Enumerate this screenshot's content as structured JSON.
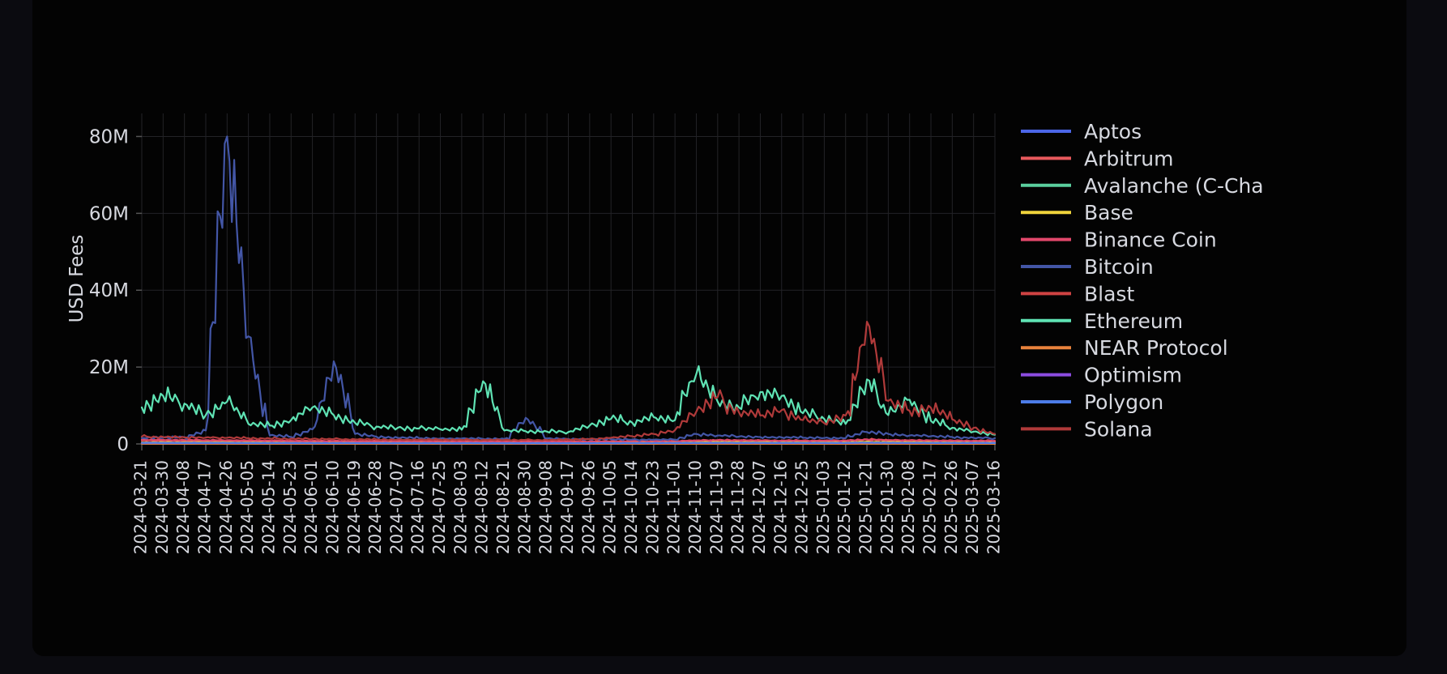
{
  "page": {
    "background_color": "#0b0b10",
    "card_color": "#030303"
  },
  "chart_data": {
    "type": "line",
    "title": "",
    "xlabel": "",
    "ylabel": "USD Fees",
    "ylim": [
      0,
      86000000
    ],
    "yticks": [
      0,
      20000000,
      40000000,
      60000000,
      80000000
    ],
    "ytick_labels": [
      "0",
      "20M",
      "40M",
      "60M",
      "80M"
    ],
    "grid": true,
    "legend_position": "right",
    "x_label_rotation": -90,
    "categories": [
      "2024-03-21",
      "2024-03-30",
      "2024-04-08",
      "2024-04-17",
      "2024-04-26",
      "2024-05-05",
      "2024-05-14",
      "2024-05-23",
      "2024-06-01",
      "2024-06-10",
      "2024-06-19",
      "2024-06-28",
      "2024-07-07",
      "2024-07-16",
      "2024-07-25",
      "2024-08-03",
      "2024-08-12",
      "2024-08-21",
      "2024-08-30",
      "2024-09-08",
      "2024-09-17",
      "2024-09-26",
      "2024-10-05",
      "2024-10-14",
      "2024-10-23",
      "2024-11-01",
      "2024-11-10",
      "2024-11-19",
      "2024-11-28",
      "2024-12-07",
      "2024-12-16",
      "2024-12-25",
      "2025-01-03",
      "2025-01-12",
      "2025-01-21",
      "2025-01-30",
      "2025-02-08",
      "2025-02-17",
      "2025-02-26",
      "2025-03-07",
      "2025-03-16"
    ],
    "series": [
      {
        "name": "Aptos",
        "color": "#4c66e8",
        "values": [
          30000,
          28000,
          26000,
          40000,
          35000,
          30000,
          28000,
          26000,
          25000,
          24000,
          23000,
          22000,
          21000,
          20000,
          20000,
          19000,
          19000,
          18000,
          18000,
          17000,
          17000,
          16000,
          16000,
          15000,
          15000,
          15000,
          14000,
          14000,
          14000,
          13000,
          13000,
          13000,
          12000,
          12000,
          12000,
          11000,
          11000,
          11000,
          10000,
          10000,
          10000
        ]
      },
      {
        "name": "Arbitrum",
        "color": "#e8595c",
        "values": [
          900000,
          850000,
          820000,
          800000,
          760000,
          700000,
          650000,
          620000,
          600000,
          580000,
          550000,
          520000,
          500000,
          480000,
          460000,
          440000,
          430000,
          420000,
          410000,
          400000,
          420000,
          450000,
          480000,
          520000,
          560000,
          620000,
          800000,
          900000,
          850000,
          800000,
          760000,
          700000,
          680000,
          700000,
          1200000,
          900000,
          820000,
          780000,
          700000,
          650000,
          600000
        ]
      },
      {
        "name": "Avalanche (C-Cha",
        "color": "#5bcf9e",
        "values": [
          250000,
          240000,
          230000,
          220000,
          210000,
          200000,
          190000,
          185000,
          180000,
          175000,
          170000,
          165000,
          160000,
          158000,
          155000,
          152000,
          150000,
          148000,
          146000,
          144000,
          142000,
          140000,
          150000,
          160000,
          170000,
          180000,
          200000,
          220000,
          210000,
          200000,
          190000,
          185000,
          180000,
          178000,
          200000,
          190000,
          180000,
          175000,
          170000,
          165000,
          160000
        ]
      },
      {
        "name": "Base",
        "color": "#f0d43c",
        "values": [
          400000,
          420000,
          450000,
          430000,
          410000,
          390000,
          370000,
          350000,
          340000,
          330000,
          320000,
          310000,
          300000,
          295000,
          290000,
          285000,
          280000,
          275000,
          270000,
          268000,
          270000,
          280000,
          300000,
          320000,
          340000,
          370000,
          450000,
          500000,
          480000,
          460000,
          440000,
          420000,
          410000,
          420000,
          600000,
          500000,
          470000,
          450000,
          420000,
          400000,
          380000
        ]
      },
      {
        "name": "Binance Coin",
        "color": "#e2486b",
        "values": [
          1100000,
          1050000,
          1000000,
          980000,
          950000,
          900000,
          860000,
          830000,
          800000,
          780000,
          760000,
          740000,
          720000,
          710000,
          700000,
          690000,
          680000,
          670000,
          665000,
          660000,
          665000,
          680000,
          700000,
          720000,
          750000,
          790000,
          900000,
          1000000,
          960000,
          930000,
          900000,
          870000,
          860000,
          880000,
          1100000,
          1000000,
          950000,
          920000,
          880000,
          850000,
          820000
        ]
      },
      {
        "name": "Bitcoin",
        "color": "#4356a6",
        "values": [
          1500000,
          1600000,
          1800000,
          3500000,
          80000000,
          28000000,
          2200000,
          1800000,
          3800000,
          21500000,
          2600000,
          1900000,
          1600000,
          1500000,
          1400000,
          1400000,
          1300000,
          1300000,
          6800000,
          1400000,
          1300000,
          1200000,
          1200000,
          1150000,
          1100000,
          1100000,
          2600000,
          2200000,
          1900000,
          1800000,
          1700000,
          1600000,
          1550000,
          1500000,
          3100000,
          2600000,
          2200000,
          2000000,
          1800000,
          1600000,
          1500000
        ]
      },
      {
        "name": "Blast",
        "color": "#cf4343",
        "values": [
          120000,
          115000,
          110000,
          105000,
          100000,
          95000,
          92000,
          90000,
          88000,
          86000,
          84000,
          82000,
          80000,
          79000,
          78000,
          77000,
          76000,
          75000,
          74000,
          73000,
          72000,
          71000,
          70000,
          69000,
          68000,
          67000,
          66000,
          65000,
          64000,
          63000,
          62000,
          61000,
          60000,
          59000,
          58000,
          57000,
          56000,
          55000,
          54000,
          53000,
          52000
        ]
      },
      {
        "name": "Ethereum",
        "color": "#5fe3b4",
        "values": [
          9500000,
          12500000,
          10500000,
          7500000,
          11000000,
          5200000,
          4800000,
          6200000,
          9500000,
          7500000,
          5500000,
          4500000,
          4200000,
          4000000,
          3800000,
          3700000,
          16300000,
          3500000,
          3300000,
          3200000,
          3100000,
          4800000,
          6500000,
          5500000,
          7000000,
          6200000,
          18200000,
          11000000,
          9500000,
          13500000,
          12500000,
          8000000,
          6500000,
          5200000,
          16800000,
          7500000,
          11500000,
          6000000,
          4200000,
          3200000,
          2400000
        ]
      },
      {
        "name": "NEAR Protocol",
        "color": "#e8823c",
        "values": [
          60000,
          58000,
          56000,
          54000,
          52000,
          50000,
          49000,
          48000,
          47000,
          46000,
          45000,
          44000,
          43000,
          43000,
          42000,
          42000,
          41000,
          41000,
          40000,
          40000,
          40000,
          39000,
          39000,
          38000,
          38000,
          38000,
          37000,
          37000,
          37000,
          36000,
          36000,
          36000,
          35000,
          35000,
          35000,
          34000,
          34000,
          34000,
          33000,
          33000,
          33000
        ]
      },
      {
        "name": "Optimism",
        "color": "#8c4ce0",
        "values": [
          300000,
          290000,
          285000,
          280000,
          270000,
          260000,
          255000,
          250000,
          245000,
          240000,
          235000,
          230000,
          228000,
          225000,
          222000,
          220000,
          218000,
          215000,
          213000,
          212000,
          212000,
          215000,
          220000,
          228000,
          235000,
          245000,
          280000,
          300000,
          290000,
          280000,
          272000,
          265000,
          260000,
          265000,
          330000,
          300000,
          285000,
          275000,
          265000,
          258000,
          250000
        ]
      },
      {
        "name": "Polygon",
        "color": "#4c7ce8",
        "values": [
          280000,
          270000,
          265000,
          260000,
          255000,
          248000,
          242000,
          238000,
          234000,
          230000,
          226000,
          222000,
          219000,
          216000,
          214000,
          212000,
          210000,
          208000,
          206000,
          205000,
          205000,
          208000,
          214000,
          220000,
          228000,
          238000,
          270000,
          290000,
          280000,
          270000,
          262000,
          255000,
          250000,
          255000,
          320000,
          290000,
          275000,
          265000,
          256000,
          248000,
          240000
        ]
      },
      {
        "name": "Solana",
        "color": "#b03a3a",
        "values": [
          1900000,
          1800000,
          1700000,
          1650000,
          1600000,
          1500000,
          1400000,
          1350000,
          1300000,
          1250000,
          1200000,
          1150000,
          1120000,
          1100000,
          1080000,
          1060000,
          1050000,
          1030000,
          1020000,
          1010000,
          1100000,
          1300000,
          1600000,
          2000000,
          2600000,
          3600000,
          8400000,
          12200000,
          8200000,
          7400000,
          8800000,
          6200000,
          5400000,
          7400000,
          31800000,
          11200000,
          8600000,
          9400000,
          6400000,
          4200000,
          2600000
        ]
      }
    ]
  },
  "legend": {
    "items": [
      {
        "label": "Aptos",
        "color": "#4c66e8"
      },
      {
        "label": "Arbitrum",
        "color": "#e8595c"
      },
      {
        "label": "Avalanche (C-Cha",
        "color": "#5bcf9e"
      },
      {
        "label": "Base",
        "color": "#f0d43c"
      },
      {
        "label": "Binance Coin",
        "color": "#e2486b"
      },
      {
        "label": "Bitcoin",
        "color": "#4356a6"
      },
      {
        "label": "Blast",
        "color": "#cf4343"
      },
      {
        "label": "Ethereum",
        "color": "#5fe3b4"
      },
      {
        "label": "NEAR Protocol",
        "color": "#e8823c"
      },
      {
        "label": "Optimism",
        "color": "#8c4ce0"
      },
      {
        "label": "Polygon",
        "color": "#4c7ce8"
      },
      {
        "label": "Solana",
        "color": "#b03a3a"
      }
    ]
  }
}
